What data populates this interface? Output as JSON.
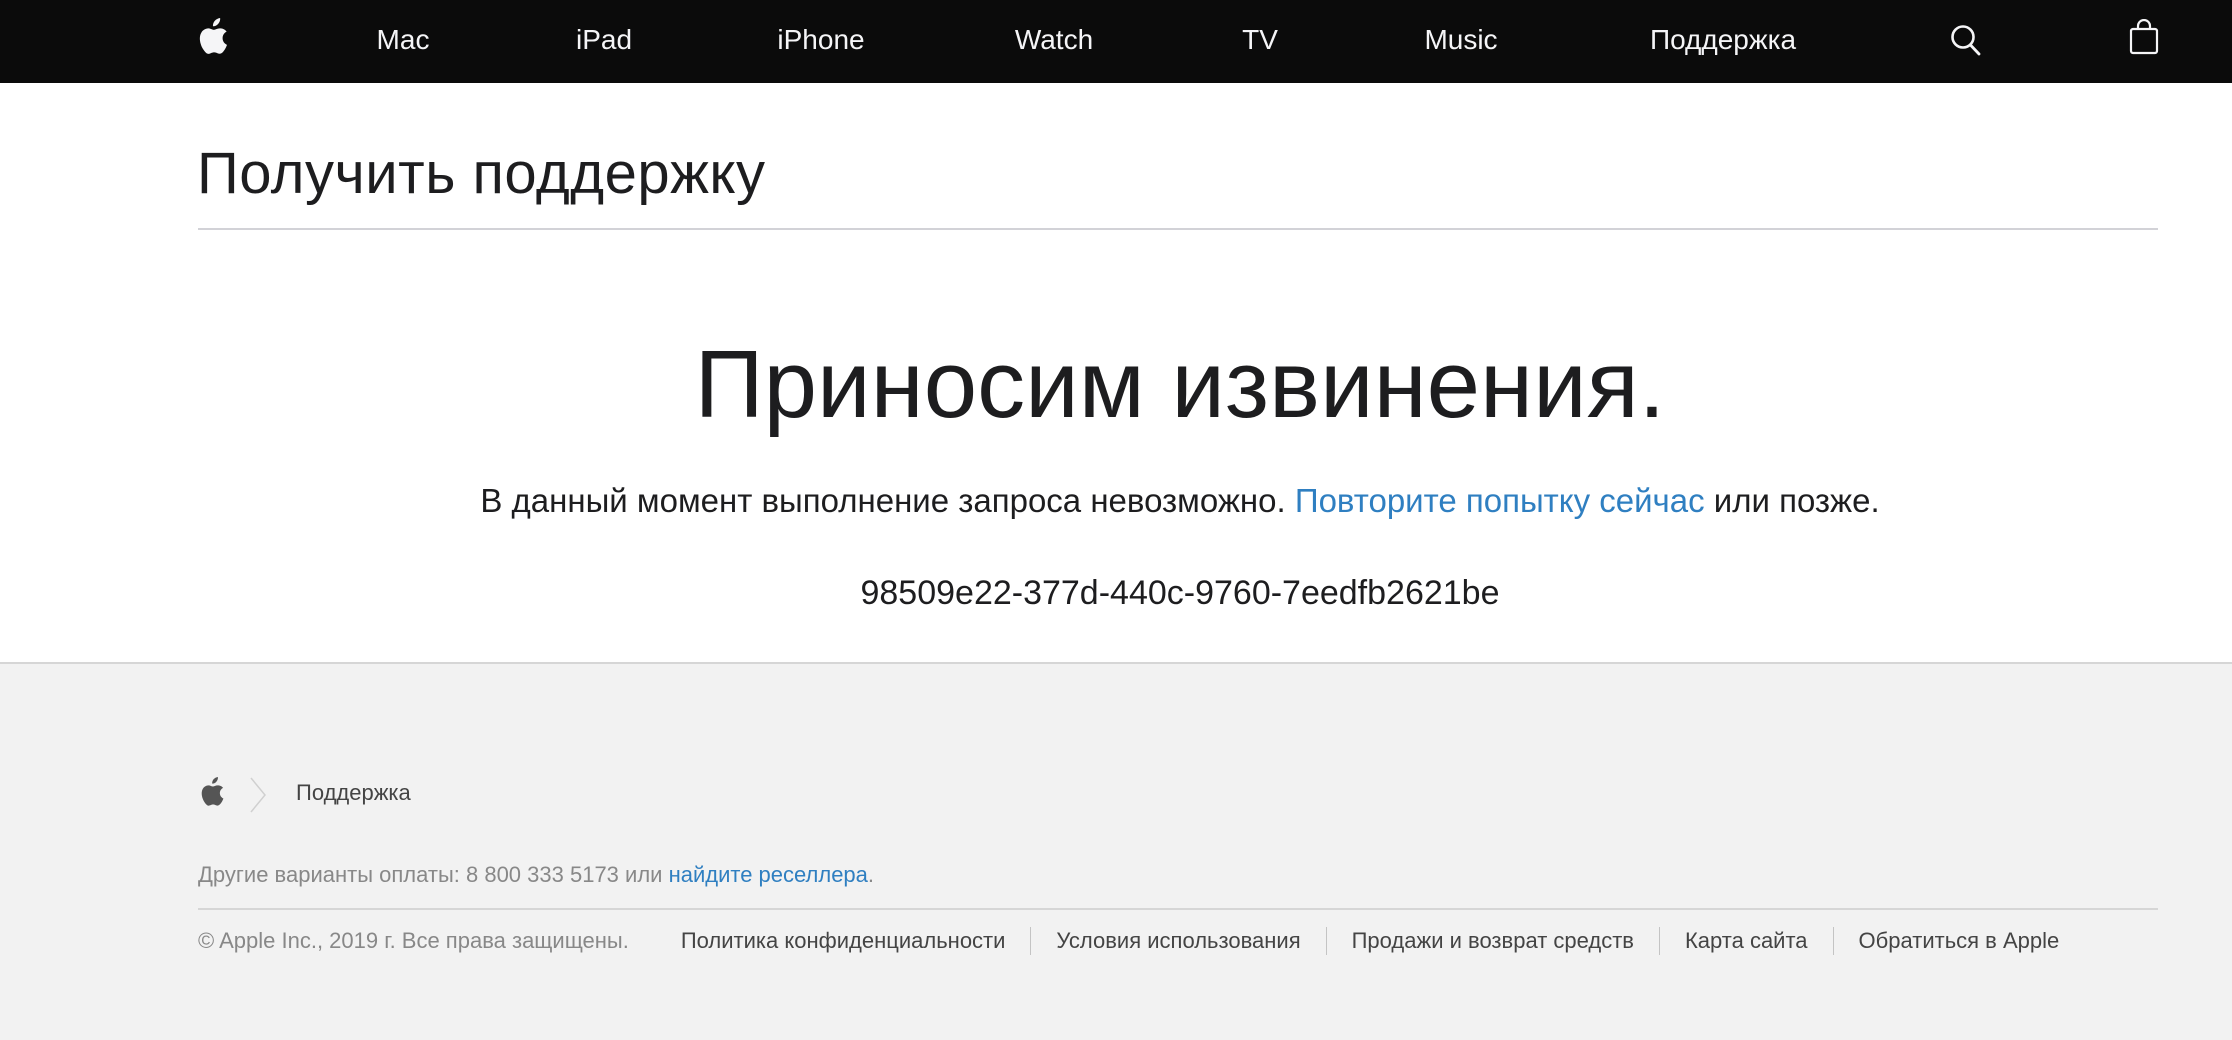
{
  "nav": {
    "items": [
      {
        "label": "Mac"
      },
      {
        "label": "iPad"
      },
      {
        "label": "iPhone"
      },
      {
        "label": "Watch"
      },
      {
        "label": "TV"
      },
      {
        "label": "Music"
      },
      {
        "label": "Поддержка"
      }
    ],
    "icons": [
      "apple-logo-icon",
      "search-icon",
      "bag-icon"
    ]
  },
  "page": {
    "title": "Получить поддержку"
  },
  "error": {
    "heading": "Приносим извинения.",
    "text_before": "В данный момент выполнение запроса невозможно. ",
    "retry_link": "Повторите попытку сейчас",
    "text_after": " или позже.",
    "code": "98509e22-377d-440c-9760-7eedfb2621be"
  },
  "footer": {
    "breadcrumb": "Поддержка",
    "shop_text": "Другие варианты оплаты: 8 800 333 5173 или ",
    "shop_link": "найдите реселлера",
    "shop_end": ".",
    "copyright": "© Apple Inc., 2019 г. Все права защищены.",
    "links": [
      {
        "label": "Политика конфиденциальности"
      },
      {
        "label": "Условия использования"
      },
      {
        "label": "Продажи и возврат средств"
      },
      {
        "label": "Карта сайта"
      },
      {
        "label": "Обратиться в Apple"
      }
    ]
  },
  "colors": {
    "nav_background": "#0b0b0b",
    "link": "#2f7fc1",
    "footer_background": "#f2f2f2"
  }
}
